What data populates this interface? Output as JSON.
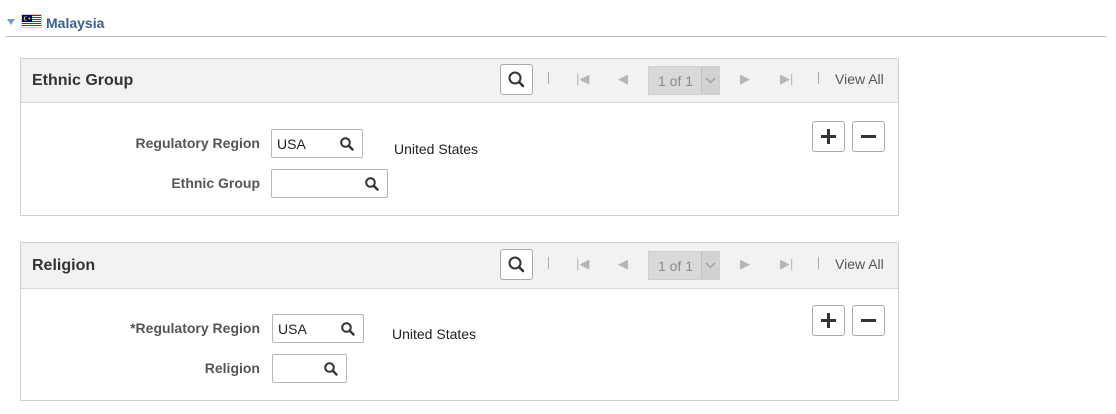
{
  "section": {
    "title": "Malaysia",
    "collapse_icon": "collapse-triangle-icon",
    "flag_icon": "malaysia-flag-icon"
  },
  "ethnic_group_grid": {
    "title": "Ethnic Group",
    "page_count": "1 of 1",
    "view_all": "View All",
    "regulatory_region_label": "Regulatory Region",
    "regulatory_region_value": "USA",
    "regulatory_region_desc": "United States",
    "ethnic_group_label": "Ethnic Group",
    "ethnic_group_value": ""
  },
  "religion_grid": {
    "title": "Religion",
    "page_count": "1 of 1",
    "view_all": "View All",
    "regulatory_region_label": "*Regulatory Region",
    "regulatory_region_value": "USA",
    "regulatory_region_desc": "United States",
    "religion_label": "Religion",
    "religion_value": ""
  },
  "colors": {
    "section_title": "#3a5f8f",
    "header_bg": "#f2f2f2"
  }
}
